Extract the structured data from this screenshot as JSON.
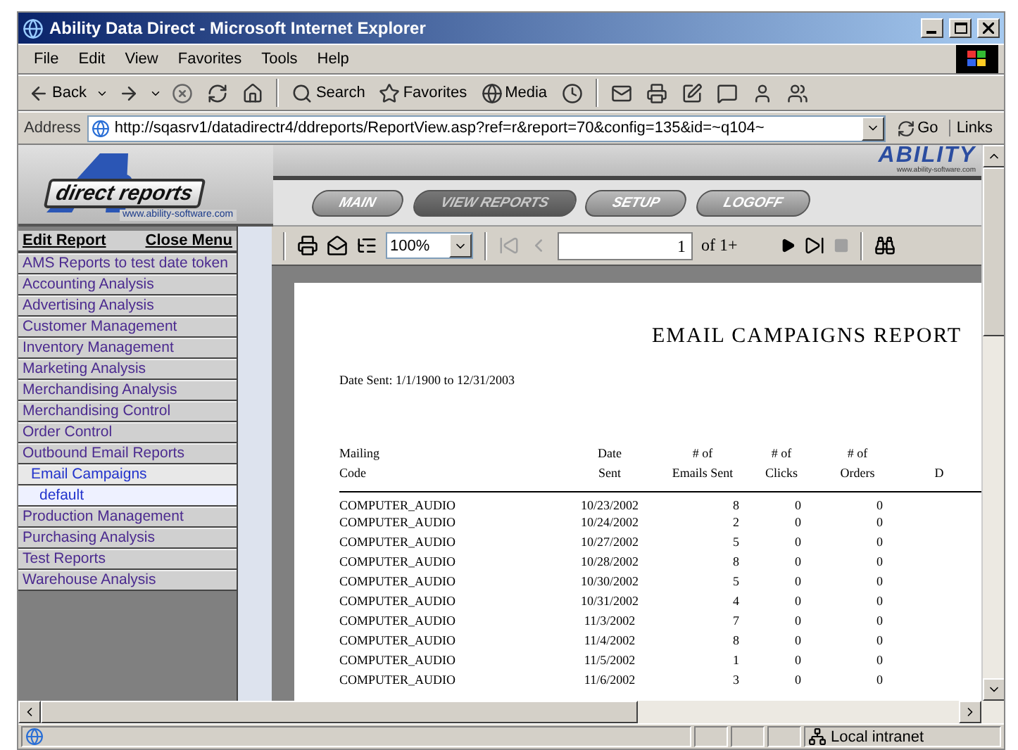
{
  "window": {
    "title": "Ability Data Direct - Microsoft Internet Explorer"
  },
  "menu": [
    "File",
    "Edit",
    "View",
    "Favorites",
    "Tools",
    "Help"
  ],
  "toolbar": [
    {
      "kind": "back",
      "label": "Back"
    },
    {
      "kind": "forward"
    },
    {
      "kind": "stop"
    },
    {
      "kind": "refresh"
    },
    {
      "kind": "home"
    },
    {
      "kind": "search",
      "label": "Search"
    },
    {
      "kind": "favorites",
      "label": "Favorites"
    },
    {
      "kind": "media",
      "label": "Media"
    },
    {
      "kind": "history"
    },
    {
      "kind": "mail"
    },
    {
      "kind": "print"
    },
    {
      "kind": "edit"
    },
    {
      "kind": "discuss"
    },
    {
      "kind": "messenger"
    },
    {
      "kind": "contacts"
    }
  ],
  "address": {
    "label": "Address",
    "value": "http://sqasrv1/datadirectr4/ddreports/ReportView.asp?ref=r&report=70&config=135&id=~q104~",
    "go": "Go",
    "links": "Links"
  },
  "site": {
    "logo_text": "direct reports",
    "logo_url": "www.ability-software.com",
    "brand": "ABILITY",
    "brand_url": "www.ability-software.com",
    "nav": [
      {
        "label": "MAIN",
        "selected": false
      },
      {
        "label": "VIEW REPORTS",
        "selected": true
      },
      {
        "label": "SETUP",
        "selected": false
      },
      {
        "label": "LOGOFF",
        "selected": false
      }
    ]
  },
  "sidebar": {
    "actions": [
      "Edit Report",
      "Close Menu"
    ],
    "items": [
      {
        "label": "AMS Reports to test date token",
        "selected": false
      },
      {
        "label": "Accounting Analysis",
        "selected": false
      },
      {
        "label": "Advertising Analysis",
        "selected": false
      },
      {
        "label": "Customer Management",
        "selected": false
      },
      {
        "label": "Inventory Management",
        "selected": false
      },
      {
        "label": "Marketing Analysis",
        "selected": false
      },
      {
        "label": "Merchandising Analysis",
        "selected": false
      },
      {
        "label": "Merchandising Control",
        "selected": false
      },
      {
        "label": "Order Control",
        "selected": false
      },
      {
        "label": "Outbound Email Reports",
        "selected": false,
        "children": [
          {
            "label": "Email Campaigns",
            "selected": false,
            "children": [
              {
                "label": "default",
                "selected": true
              }
            ]
          }
        ]
      },
      {
        "label": "Production Management",
        "selected": false
      },
      {
        "label": "Purchasing Analysis",
        "selected": false
      },
      {
        "label": "Test Reports",
        "selected": false
      },
      {
        "label": "Warehouse Analysis",
        "selected": false
      }
    ]
  },
  "viewer": {
    "tools": [
      {
        "kind": "print"
      },
      {
        "kind": "export"
      },
      {
        "kind": "tree"
      }
    ],
    "zoom": "100%",
    "pager_before": [
      {
        "kind": "first",
        "disabled": true
      },
      {
        "kind": "previous",
        "disabled": true
      }
    ],
    "page": "1",
    "page_count": "of 1+",
    "pager_after": [
      {
        "kind": "next",
        "disabled": false
      },
      {
        "kind": "last",
        "disabled": false
      },
      {
        "kind": "stop",
        "disabled": true
      }
    ],
    "find": {
      "kind": "find"
    }
  },
  "report": {
    "title": "EMAIL CAMPAIGNS REPORT",
    "subtitle": "Date Sent: 1/1/1900 to 12/31/2003",
    "columns": [
      {
        "lines": [
          "Mailing",
          "Code"
        ]
      },
      {
        "lines": [
          "Date",
          "Sent"
        ]
      },
      {
        "lines": [
          "# of",
          "Emails Sent"
        ]
      },
      {
        "lines": [
          "# of",
          "Clicks"
        ]
      },
      {
        "lines": [
          "# of",
          "Orders"
        ]
      },
      {
        "lines": [
          "D"
        ]
      }
    ],
    "rows": [
      [
        "COMPUTER_AUDIO",
        "10/23/2002",
        "8",
        "0",
        "0"
      ],
      [
        "COMPUTER_AUDIO",
        "10/24/2002",
        "2",
        "0",
        "0"
      ],
      [
        "COMPUTER_AUDIO",
        "10/27/2002",
        "5",
        "0",
        "0"
      ],
      [
        "COMPUTER_AUDIO",
        "10/28/2002",
        "8",
        "0",
        "0"
      ],
      [
        "COMPUTER_AUDIO",
        "10/30/2002",
        "5",
        "0",
        "0"
      ],
      [
        "COMPUTER_AUDIO",
        "10/31/2002",
        "4",
        "0",
        "0"
      ],
      [
        "COMPUTER_AUDIO",
        "11/3/2002",
        "7",
        "0",
        "0"
      ],
      [
        "COMPUTER_AUDIO",
        "11/4/2002",
        "8",
        "0",
        "0"
      ],
      [
        "COMPUTER_AUDIO",
        "11/5/2002",
        "1",
        "0",
        "0"
      ],
      [
        "COMPUTER_AUDIO",
        "11/6/2002",
        "3",
        "0",
        "0"
      ]
    ]
  },
  "status_bar": {
    "zone": "Local intranet"
  }
}
